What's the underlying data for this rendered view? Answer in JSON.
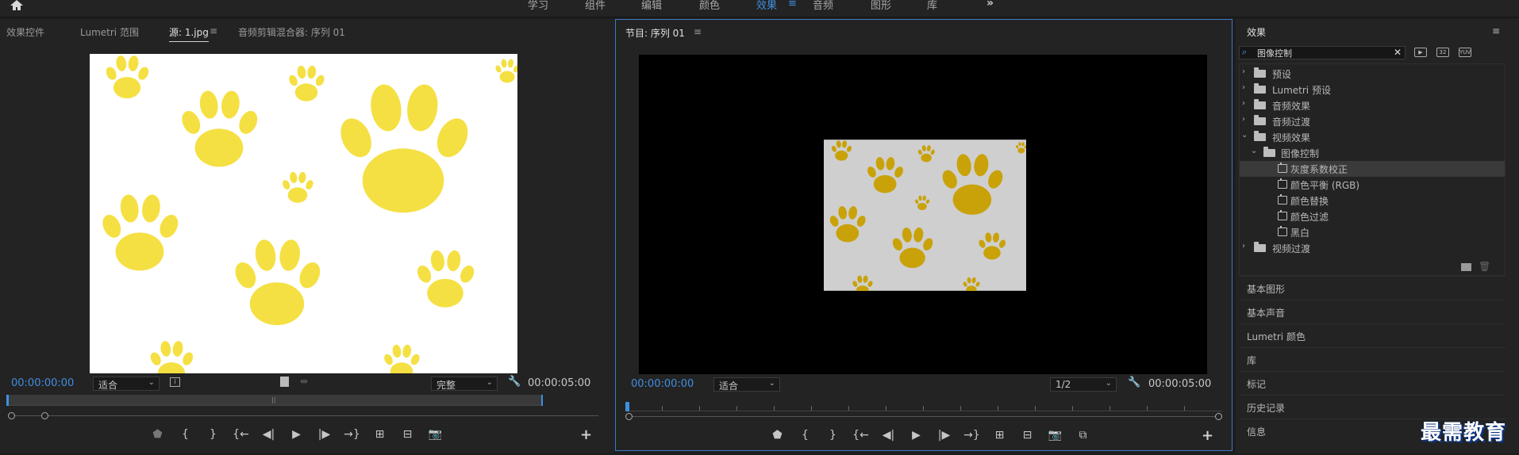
{
  "workspaces": [
    {
      "label": "学习",
      "active": false
    },
    {
      "label": "组件",
      "active": false
    },
    {
      "label": "编辑",
      "active": false
    },
    {
      "label": "颜色",
      "active": false
    },
    {
      "label": "效果",
      "active": true
    },
    {
      "label": "音频",
      "active": false
    },
    {
      "label": "图形",
      "active": false
    },
    {
      "label": "库",
      "active": false
    }
  ],
  "workspace_menu": "≡",
  "workspace_more": "»",
  "source_panel": {
    "tabs": [
      "效果控件",
      "Lumetri 范围",
      "源: 1.jpg",
      "音频剪辑混合器: 序列 01"
    ],
    "active_tab_menu": "≡",
    "timecode_current": "00:00:00:00",
    "timecode_end": "00:00:05:00",
    "fit_label": "适合",
    "quality_label": "完整"
  },
  "program_panel": {
    "title": "节目: 序列 01",
    "title_menu": "≡",
    "timecode_current": "00:00:00:00",
    "timecode_end": "00:00:05:00",
    "fit_label": "适合",
    "resolution_label": "1/2"
  },
  "effects_panel": {
    "title": "效果",
    "title_menu": "≡",
    "search_value": "图像控制",
    "tree": [
      {
        "label": "预设",
        "type": "folder-special",
        "level": 0,
        "expanded": false
      },
      {
        "label": "Lumetri 预设",
        "type": "folder-special",
        "level": 0,
        "expanded": false
      },
      {
        "label": "音频效果",
        "type": "folder",
        "level": 0,
        "expanded": false
      },
      {
        "label": "音频过渡",
        "type": "folder",
        "level": 0,
        "expanded": false
      },
      {
        "label": "视频效果",
        "type": "folder",
        "level": 0,
        "expanded": true
      },
      {
        "label": "图像控制",
        "type": "folder",
        "level": 1,
        "expanded": true
      },
      {
        "label": "灰度系数校正",
        "type": "effect",
        "level": 2,
        "selected": true
      },
      {
        "label": "颜色平衡 (RGB)",
        "type": "effect",
        "level": 2
      },
      {
        "label": "颜色替换",
        "type": "effect",
        "level": 2
      },
      {
        "label": "颜色过滤",
        "type": "effect",
        "level": 2
      },
      {
        "label": "黑白",
        "type": "effect",
        "level": 2
      },
      {
        "label": "视频过渡",
        "type": "folder",
        "level": 0,
        "expanded": false
      }
    ],
    "sections": [
      "基本图形",
      "基本声音",
      "Lumetri 颜色",
      "库",
      "标记",
      "历史记录",
      "信息"
    ]
  },
  "watermark": "最需教育",
  "colors": {
    "accent": "#3f8fe0",
    "paw_yellow": "#f5e043",
    "paw_gold": "#c9a20a",
    "program_frame_bg": "#cfcfcf"
  }
}
